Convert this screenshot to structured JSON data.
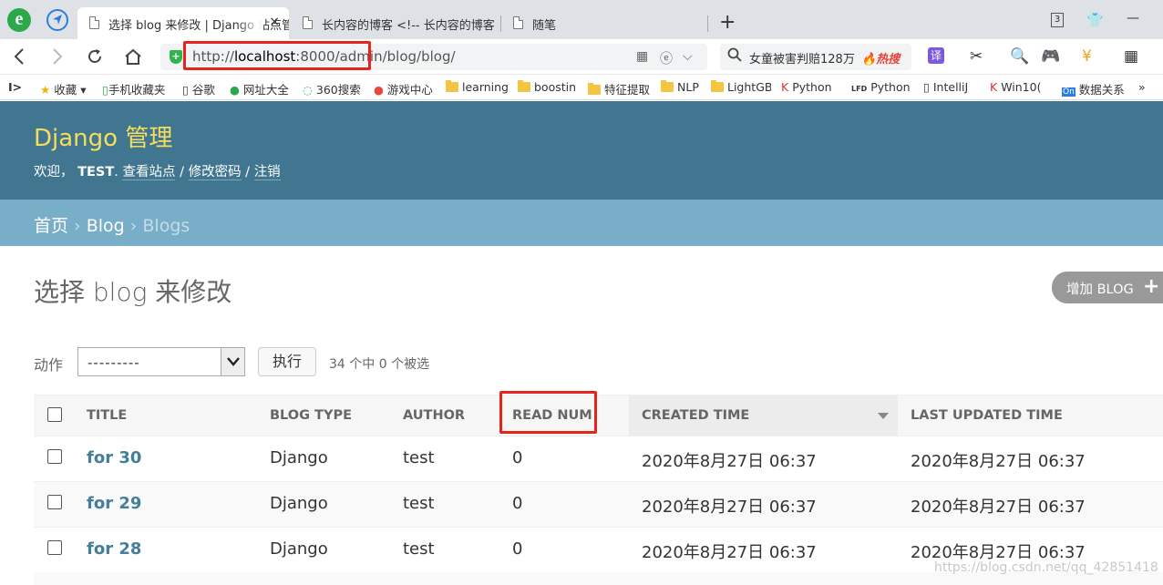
{
  "browser": {
    "tabs": [
      {
        "title": "选择 blog 来修改 | Django 站点管理",
        "active": true
      },
      {
        "title": "长内容的博客 <!-- 长内容的博客",
        "active": false
      },
      {
        "title": "随笔",
        "active": false
      }
    ],
    "close_glyph": "×",
    "new_tab_glyph": "+",
    "window_badge": "3",
    "url_prefix": "http://",
    "url_host": "localhost",
    "url_rest": ":8000/admin/blog/blog/",
    "search_text": "女童被害判赔128万",
    "search_hot": "🔥热搜",
    "bookmarks": [
      {
        "label": "收藏",
        "icon": "star-icon"
      },
      {
        "label": "手机收藏夹",
        "icon": "phone-icon"
      },
      {
        "label": "谷歌",
        "icon": "page-icon"
      },
      {
        "label": "网址大全",
        "icon": "globe-icon"
      },
      {
        "label": "360搜索",
        "icon": "search360-icon"
      },
      {
        "label": "游戏中心",
        "icon": "game-icon"
      },
      {
        "label": "learning",
        "icon": "folder-icon"
      },
      {
        "label": "boostin",
        "icon": "folder-icon"
      },
      {
        "label": "特征提取",
        "icon": "folder-icon"
      },
      {
        "label": "NLP",
        "icon": "folder-icon"
      },
      {
        "label": "LightGB",
        "icon": "folder-icon"
      },
      {
        "label": "Python",
        "icon": "python-icon"
      },
      {
        "label": "Python",
        "icon": "lfd-icon"
      },
      {
        "label": "IntelliJ",
        "icon": "page-icon"
      },
      {
        "label": "Win10(",
        "icon": "win-icon"
      },
      {
        "label": "数据关系",
        "icon": "on-icon"
      }
    ],
    "bookmark_more": "»"
  },
  "admin": {
    "site_name": "Django 管理",
    "welcome": "欢迎，",
    "username": "TEST",
    "links": [
      "查看站点",
      "修改密码",
      "注销"
    ],
    "breadcrumbs": [
      "首页",
      "Blog",
      "Blogs"
    ],
    "page_title": "选择 blog 来修改",
    "add_button": "增加 BLOG",
    "actions_label": "动作",
    "action_select_value": "---------",
    "run_button": "执行",
    "selection_count": "34 个中 0 个被选",
    "columns": [
      "TITLE",
      "BLOG TYPE",
      "AUTHOR",
      "READ NUM",
      "CREATED TIME",
      "LAST UPDATED TIME"
    ],
    "rows": [
      [
        "for 30",
        "Django",
        "test",
        "0",
        "2020年8月27日 06:37",
        "2020年8月27日 06:37"
      ],
      [
        "for 29",
        "Django",
        "test",
        "0",
        "2020年8月27日 06:37",
        "2020年8月27日 06:37"
      ],
      [
        "for 28",
        "Django",
        "test",
        "0",
        "2020年8月27日 06:37",
        "2020年8月27日 06:37"
      ]
    ]
  },
  "watermark": "https://blog.csdn.net/qq_42851418",
  "colors": {
    "header": "#417690",
    "brand": "#f5dd5d",
    "breadcrumbs": "#79aec8",
    "link": "#447e9b",
    "highlight": "#e8231d"
  }
}
